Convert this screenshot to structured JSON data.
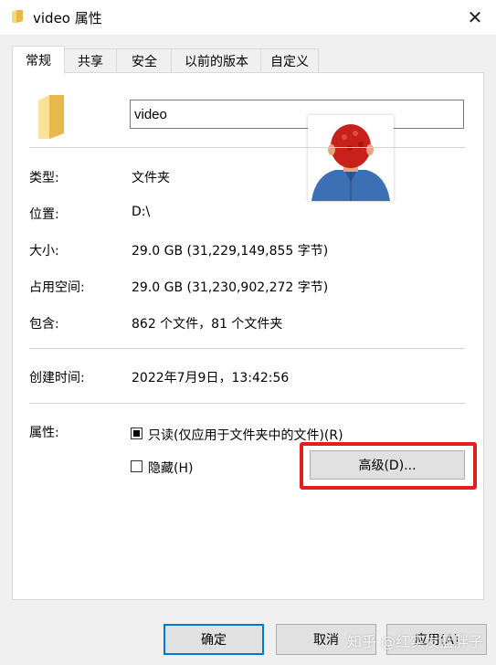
{
  "window": {
    "title": "video 属性",
    "close_symbol": "✕"
  },
  "tabs": [
    {
      "label": "常规"
    },
    {
      "label": "共享"
    },
    {
      "label": "安全"
    },
    {
      "label": "以前的版本"
    },
    {
      "label": "自定义"
    }
  ],
  "general": {
    "name": "video",
    "rows": [
      {
        "label": "类型:",
        "value": "文件夹"
      },
      {
        "label": "位置:",
        "value": "D:\\"
      },
      {
        "label": "大小:",
        "value": "29.0 GB (31,229,149,855 字节)"
      },
      {
        "label": "占用空间:",
        "value": "29.0 GB (31,230,902,272 字节)"
      },
      {
        "label": "包含:",
        "value": "862 个文件，81 个文件夹"
      }
    ],
    "created_label": "创建时间:",
    "created_value": "2022年7月9日，13:42:56",
    "attributes_label": "属性:",
    "readonly_label": "只读(仅应用于文件夹中的文件)(R)",
    "hidden_label": "隐藏(H)",
    "advanced_button": "高级(D)..."
  },
  "footer": {
    "ok": "确定",
    "cancel": "取消",
    "apply": "应用(A)"
  },
  "watermark": "知乎 @红实发蓝胖子",
  "colors": {
    "folder": "#f8d775",
    "highlight": "#e02020",
    "accent": "#0078d7"
  },
  "state": {
    "readonly": "indeterminate",
    "hidden": false,
    "active_tab": 0
  }
}
